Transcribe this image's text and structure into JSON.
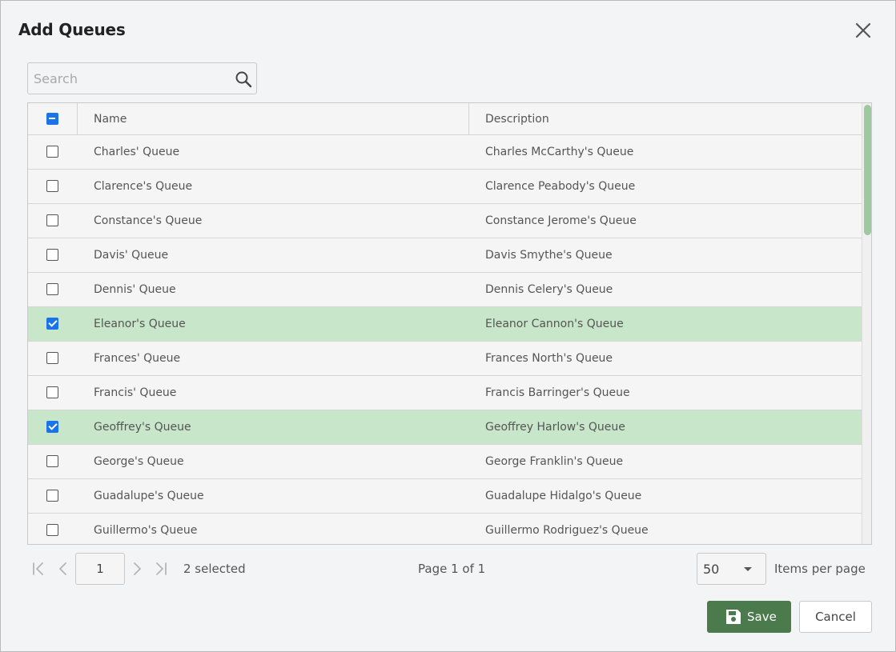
{
  "dialog": {
    "title": "Add Queues"
  },
  "search": {
    "placeholder": "Search",
    "value": ""
  },
  "table": {
    "columns": [
      "Name",
      "Description"
    ],
    "rows": [
      {
        "name": "Charles' Queue",
        "description": "Charles McCarthy's Queue",
        "checked": false
      },
      {
        "name": "Clarence's Queue",
        "description": "Clarence Peabody's Queue",
        "checked": false
      },
      {
        "name": "Constance's Queue",
        "description": "Constance Jerome's Queue",
        "checked": false
      },
      {
        "name": "Davis' Queue",
        "description": "Davis Smythe's Queue",
        "checked": false
      },
      {
        "name": "Dennis' Queue",
        "description": "Dennis Celery's Queue",
        "checked": false
      },
      {
        "name": "Eleanor's Queue",
        "description": "Eleanor Cannon's Queue",
        "checked": true
      },
      {
        "name": "Frances' Queue",
        "description": "Frances North's Queue",
        "checked": false
      },
      {
        "name": "Francis' Queue",
        "description": "Francis Barringer's Queue",
        "checked": false
      },
      {
        "name": "Geoffrey's Queue",
        "description": "Geoffrey Harlow's Queue",
        "checked": true
      },
      {
        "name": "George's Queue",
        "description": "George Franklin's Queue",
        "checked": false
      },
      {
        "name": "Guadalupe's Queue",
        "description": "Guadalupe Hidalgo's Queue",
        "checked": false
      },
      {
        "name": "Guillermo's Queue",
        "description": "Guillermo Rodriguez's Queue",
        "checked": false
      }
    ],
    "header_checkbox": "indeterminate",
    "selected_row_color": "#c8e6c9",
    "scroll_position": 0.0
  },
  "pager": {
    "page_value": "1",
    "selected_text": "2 selected",
    "page_text": "Page 1 of 1",
    "per_page_value": "50",
    "per_page_label": "Items per page"
  },
  "footer": {
    "save_label": "Save",
    "cancel_label": "Cancel"
  },
  "colors": {
    "accent": "#1a73e8",
    "save_button": "#4b7a4c",
    "scroll_thumb": "#9cc99e"
  },
  "icons": [
    "close-icon",
    "search-icon",
    "first-page-icon",
    "prev-page-icon",
    "next-page-icon",
    "last-page-icon",
    "chevron-down-icon",
    "save-icon"
  ]
}
